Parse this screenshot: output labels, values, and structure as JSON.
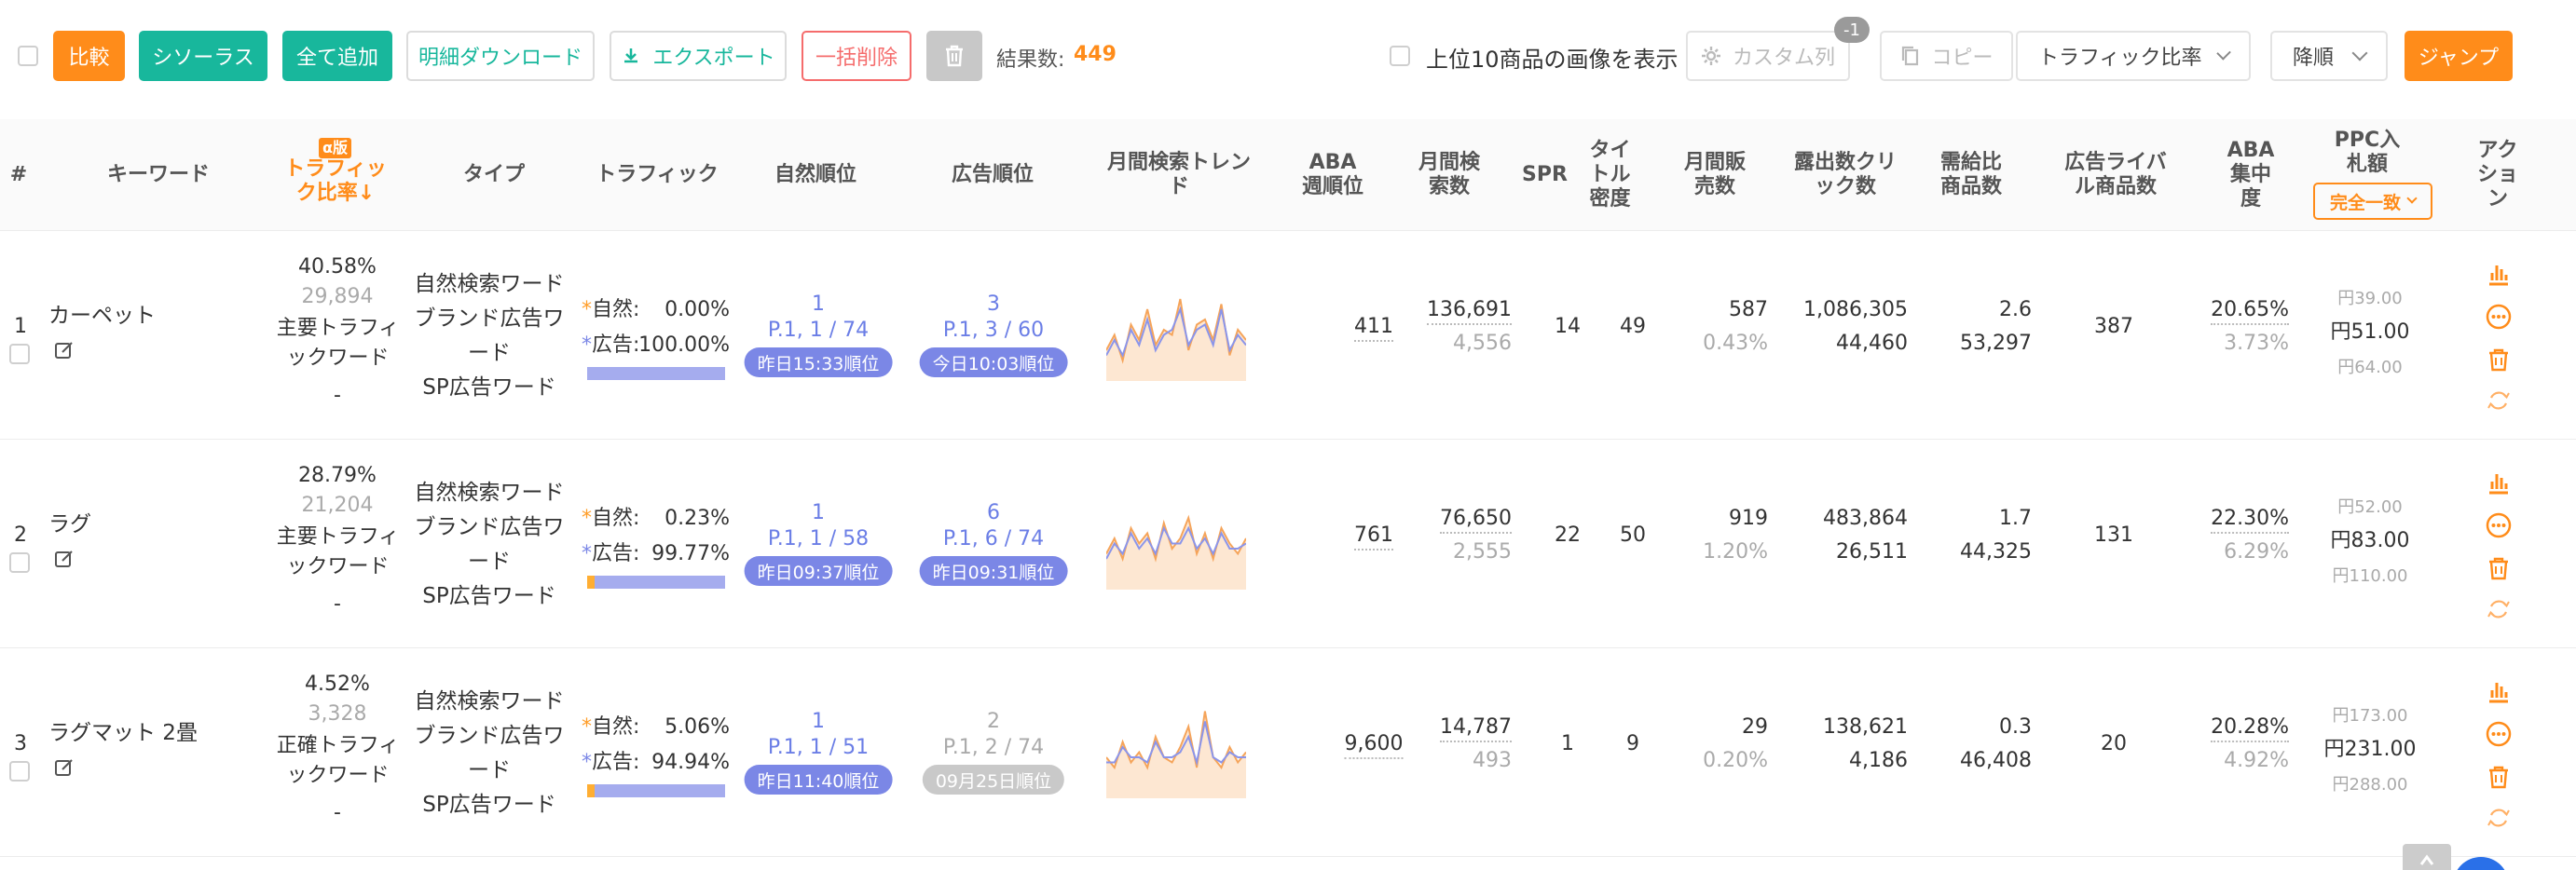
{
  "toolbar": {
    "compare": "比較",
    "thesaurus": "シソーラス",
    "add_all": "全て追加",
    "detail_download": "明細ダウンロード",
    "export": "エクスポート",
    "bulk_delete": "一括削除",
    "result_label": "結果数:",
    "result_count": "449",
    "show_images": "上位10商品の画像を表示",
    "custom_columns": "カスタム列",
    "custom_badge": "-1",
    "copy": "コピー",
    "sort_field": "トラフィック比率",
    "sort_order": "降順",
    "jump": "ジャンプ"
  },
  "header": {
    "index": "#",
    "keyword": "キーワード",
    "alpha": "α版",
    "traffic_ratio": "トラフィック比率↓",
    "type": "タイプ",
    "traffic": "トラフィック",
    "natural_rank": "自然順位",
    "ad_rank": "広告順位",
    "monthly_trend": "月間検索トレンド",
    "aba_weekly": "ABA週順位",
    "monthly_search": "月間検索数",
    "spr": "SPR",
    "title_density": "タイトル密度",
    "monthly_sales": "月間販売数",
    "impressions_clicks": "露出数クリック数",
    "supply_demand": "需給比商品数",
    "ad_rivals": "広告ライバル商品数",
    "aba_concentration": "ABA集中度",
    "ppc_bid": "PPC入札額",
    "match_type": "完全一致",
    "action": "アクション"
  },
  "rows": [
    {
      "index": "1",
      "keyword": "カーペット",
      "ratio": "40.58%",
      "ratio_count": "29,894",
      "ratio_type": "主要トラフィックワード",
      "ratio_dash": "-",
      "type_lines": [
        "自然検索ワード",
        "ブランド広告ワード",
        "SP広告ワード"
      ],
      "natural_label": "自然:",
      "natural_pct": "0.00%",
      "ad_label": "広告:",
      "ad_pct": "100.00%",
      "natural_share": 0.0,
      "nat_rank": "1",
      "nat_page": "P.1, 1 / 74",
      "nat_time": "昨日15:33順位",
      "ad_rank": "3",
      "ad_page": "P.1, 3 / 60",
      "ad_time": "今日10:03順位",
      "ad_active": true,
      "trend_a": [
        0.3,
        0.45,
        0.2,
        0.55,
        0.4,
        0.7,
        0.35,
        0.5,
        0.45,
        0.8,
        0.3,
        0.55,
        0.6,
        0.4,
        0.75,
        0.25,
        0.5,
        0.4
      ],
      "trend_b": [
        0.25,
        0.4,
        0.25,
        0.5,
        0.35,
        0.6,
        0.3,
        0.45,
        0.5,
        0.7,
        0.35,
        0.5,
        0.55,
        0.35,
        0.7,
        0.3,
        0.45,
        0.35
      ],
      "aba": "411",
      "search": "136,691",
      "search_sub": "4,556",
      "spr": "14",
      "density": "49",
      "sales": "587",
      "sales_pct": "0.43%",
      "impressions": "1,086,305",
      "clicks": "44,460",
      "supply": "2.6",
      "supply_count": "53,297",
      "rivals": "387",
      "conc": "20.65%",
      "conc_sub": "3.73%",
      "bid_low": "円39.00",
      "bid_mid": "円51.00",
      "bid_high": "円64.00"
    },
    {
      "index": "2",
      "keyword": "ラグ",
      "ratio": "28.79%",
      "ratio_count": "21,204",
      "ratio_type": "主要トラフィックワード",
      "ratio_dash": "-",
      "type_lines": [
        "自然検索ワード",
        "ブランド広告ワード",
        "SP広告ワード"
      ],
      "natural_label": "自然:",
      "natural_pct": "0.23%",
      "ad_label": "広告:",
      "ad_pct": "99.77%",
      "natural_share": 0.0023,
      "nat_rank": "1",
      "nat_page": "P.1, 1 / 58",
      "nat_time": "昨日09:37順位",
      "ad_rank": "6",
      "ad_page": "P.1, 6 / 74",
      "ad_time": "昨日09:31順位",
      "ad_active": true,
      "trend_a": [
        0.35,
        0.5,
        0.3,
        0.6,
        0.45,
        0.55,
        0.3,
        0.65,
        0.4,
        0.5,
        0.7,
        0.35,
        0.55,
        0.3,
        0.6,
        0.45,
        0.35,
        0.5
      ],
      "trend_b": [
        0.3,
        0.45,
        0.35,
        0.55,
        0.4,
        0.5,
        0.35,
        0.6,
        0.45,
        0.45,
        0.6,
        0.4,
        0.5,
        0.35,
        0.55,
        0.4,
        0.4,
        0.45
      ],
      "aba": "761",
      "search": "76,650",
      "search_sub": "2,555",
      "spr": "22",
      "density": "50",
      "sales": "919",
      "sales_pct": "1.20%",
      "impressions": "483,864",
      "clicks": "26,511",
      "supply": "1.7",
      "supply_count": "44,325",
      "rivals": "131",
      "conc": "22.30%",
      "conc_sub": "6.29%",
      "bid_low": "円52.00",
      "bid_mid": "円83.00",
      "bid_high": "円110.00"
    },
    {
      "index": "3",
      "keyword": "ラグマット 2畳",
      "ratio": "4.52%",
      "ratio_count": "3,328",
      "ratio_type": "正確トラフィックワード",
      "ratio_dash": "-",
      "type_lines": [
        "自然検索ワード",
        "ブランド広告ワード",
        "SP広告ワード"
      ],
      "natural_label": "自然:",
      "natural_pct": "5.06%",
      "ad_label": "広告:",
      "ad_pct": "94.94%",
      "natural_share": 0.0506,
      "nat_rank": "1",
      "nat_page": "P.1, 1 / 51",
      "nat_time": "昨日11:40順位",
      "ad_rank": "2",
      "ad_page": "P.1, 2 / 74",
      "ad_time": "09月25日順位",
      "ad_active": false,
      "trend_a": [
        0.4,
        0.3,
        0.55,
        0.35,
        0.45,
        0.3,
        0.6,
        0.4,
        0.35,
        0.5,
        0.7,
        0.3,
        0.85,
        0.4,
        0.3,
        0.5,
        0.35,
        0.45
      ],
      "trend_b": [
        0.35,
        0.35,
        0.5,
        0.4,
        0.4,
        0.35,
        0.55,
        0.4,
        0.4,
        0.45,
        0.6,
        0.35,
        0.75,
        0.4,
        0.35,
        0.45,
        0.4,
        0.4
      ],
      "aba": "9,600",
      "search": "14,787",
      "search_sub": "493",
      "spr": "1",
      "density": "9",
      "sales": "29",
      "sales_pct": "0.20%",
      "impressions": "138,621",
      "clicks": "4,186",
      "supply": "0.3",
      "supply_count": "46,408",
      "rivals": "20",
      "conc": "20.28%",
      "conc_sub": "4.92%",
      "bid_low": "円173.00",
      "bid_mid": "円231.00",
      "bid_high": "円288.00"
    }
  ],
  "colors": {
    "orange": "#ff8c1a",
    "teal": "#18b79c",
    "blue": "#7b87e6",
    "trend_a": "#f5a45a",
    "trend_b": "#8b95ea"
  }
}
